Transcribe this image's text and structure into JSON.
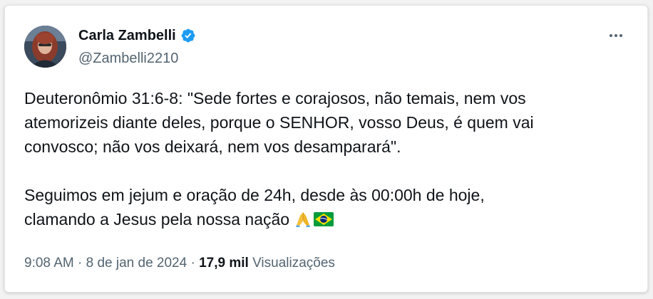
{
  "author": {
    "display_name": "Carla Zambelli",
    "handle": "@Zambelli2210",
    "verified": true,
    "verified_color": "#1d9bf0"
  },
  "tweet": {
    "line1": "Deuteronômio 31:6-8: \"Sede fortes e corajosos, não temais, nem vos",
    "line2": "atemorizeis diante deles, porque o SENHOR, vosso Deus, é quem vai",
    "line3": "convosco; não vos deixará, nem vos desamparará\".",
    "line4": "Seguimos em jejum e oração de 24h, desde às 00:00h de hoje,",
    "line5": "clamando a Jesus pela nossa nação",
    "emojis": [
      "folded-hands",
      "brazil-flag"
    ]
  },
  "meta": {
    "time": "9:08 AM",
    "separator": " · ",
    "date": "8 de jan de 2024",
    "views_count": "17,9 mil",
    "views_label": "Visualizações"
  },
  "icons": {
    "more": "more-options-icon",
    "verified": "verified-badge-icon"
  }
}
